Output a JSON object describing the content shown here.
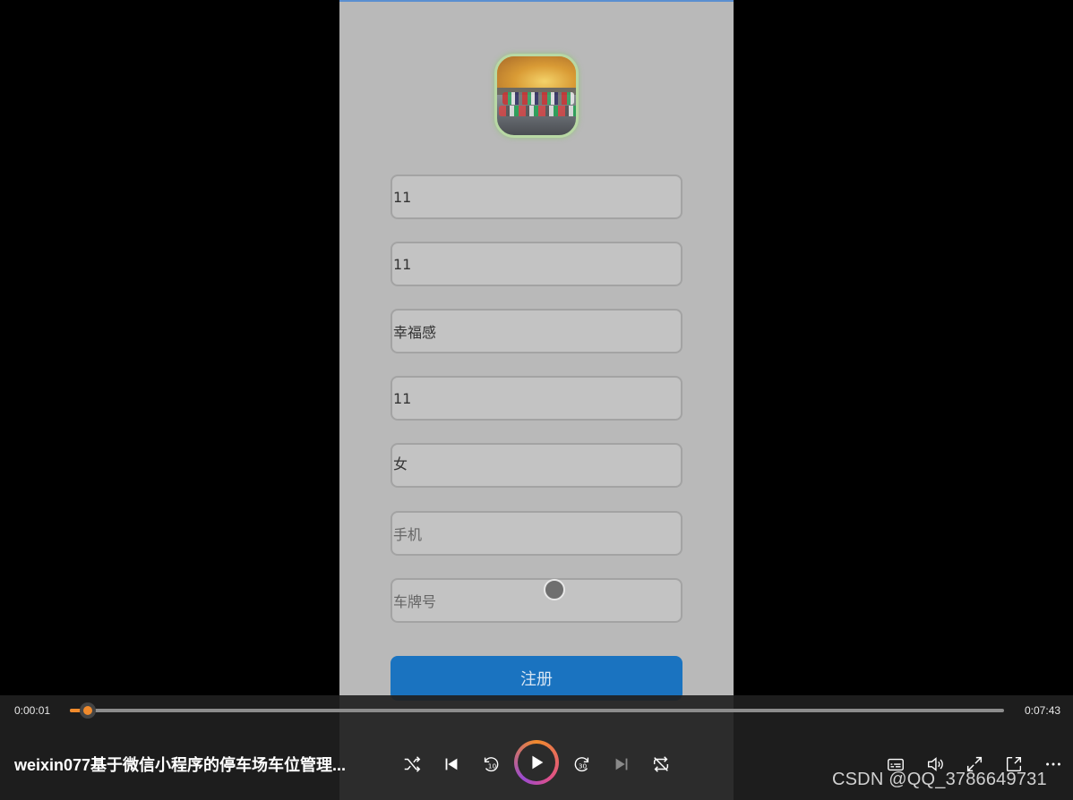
{
  "form": {
    "fields": [
      {
        "value": "11",
        "placeholder": ""
      },
      {
        "value": "11",
        "placeholder": ""
      },
      {
        "value": "幸福感",
        "placeholder": ""
      },
      {
        "value": "11",
        "placeholder": ""
      },
      {
        "value": "女",
        "placeholder": ""
      },
      {
        "value": "",
        "placeholder": "手机"
      },
      {
        "value": "",
        "placeholder": "车牌号"
      }
    ],
    "register_label": "注册"
  },
  "player": {
    "current_time": "0:00:01",
    "total_time": "0:07:43",
    "progress_fraction": 0.002,
    "title": "weixin077基于微信小程序的停车场车位管理...",
    "accent_color": "#f08a2c",
    "icons": [
      "shuffle-icon",
      "previous-icon",
      "rewind-10-icon",
      "play-icon",
      "forward-30-icon",
      "next-icon",
      "repeat-off-icon",
      "subtitles-icon",
      "volume-icon",
      "fullscreen-icon",
      "mini-player-icon",
      "more-icon"
    ]
  },
  "watermark": "CSDN @QQ_3786649731"
}
